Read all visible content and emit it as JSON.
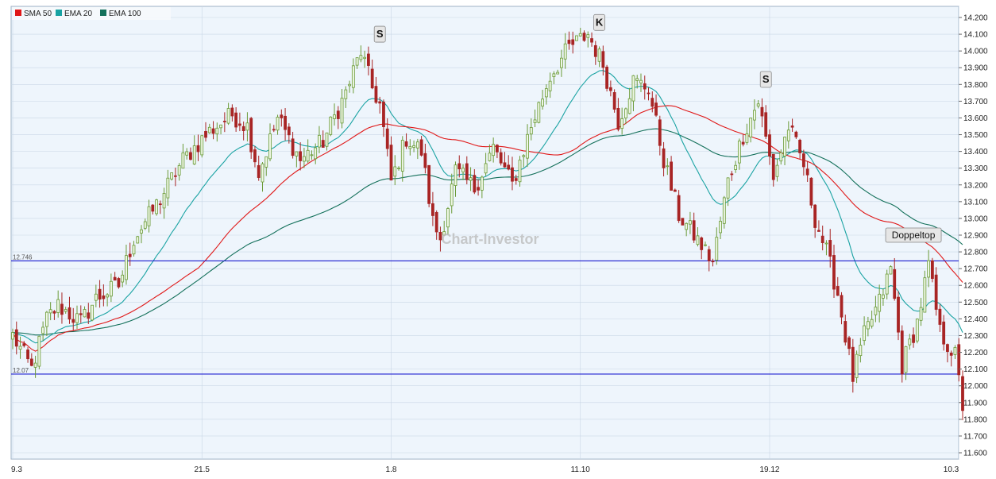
{
  "chart_data": {
    "type": "candlestick",
    "watermark": "Chart-Investor",
    "ylim": [
      11.6,
      14.2
    ],
    "grid": true,
    "legend_position": "top-left",
    "yticks": [
      "11.600",
      "11.700",
      "11.800",
      "11.900",
      "12.000",
      "12.100",
      "12.200",
      "12.300",
      "12.400",
      "12.500",
      "12.600",
      "12.700",
      "12.800",
      "12.900",
      "13.000",
      "13.100",
      "13.200",
      "13.300",
      "13.400",
      "13.500",
      "13.600",
      "13.700",
      "13.800",
      "13.900",
      "14.000",
      "14.100",
      "14.200"
    ],
    "xticks": [
      {
        "label": "9.3",
        "index": 0
      },
      {
        "label": "21.5",
        "index": 50
      },
      {
        "label": "1.8",
        "index": 100
      },
      {
        "label": "11.10",
        "index": 150
      },
      {
        "label": "19.12",
        "index": 200
      },
      {
        "label": "10.3",
        "index": 250
      }
    ],
    "n_bars": 252,
    "legend": [
      {
        "name": "SMA 50",
        "color": "#e01818"
      },
      {
        "name": "EMA 20",
        "color": "#1aa3a3"
      },
      {
        "name": "EMA 100",
        "color": "#13705a"
      }
    ],
    "hlines": [
      {
        "value": 12.746,
        "label": "12.746",
        "color": "#1a1ad0"
      },
      {
        "value": 12.07,
        "label": "12.07",
        "color": "#1a1ad0"
      }
    ],
    "annotations": [
      {
        "text": "S",
        "index": 97,
        "y": 14.1
      },
      {
        "text": "K",
        "index": 155,
        "y": 14.17
      },
      {
        "text": "S",
        "index": 199,
        "y": 13.83
      },
      {
        "text": "Doppeltop",
        "index": 238,
        "y": 12.9
      }
    ],
    "colors": {
      "up": "#6a9a36",
      "down": "#a82424",
      "plot_bg": "#eef5fc",
      "grid": "#c9d7e6"
    },
    "close_path": [
      [
        0,
        12.3
      ],
      [
        5,
        12.1
      ],
      [
        9,
        12.4
      ],
      [
        12,
        12.48
      ],
      [
        18,
        12.38
      ],
      [
        22,
        12.52
      ],
      [
        28,
        12.6
      ],
      [
        32,
        12.88
      ],
      [
        38,
        13.08
      ],
      [
        45,
        13.35
      ],
      [
        52,
        13.52
      ],
      [
        58,
        13.62
      ],
      [
        62,
        13.55
      ],
      [
        65,
        13.27
      ],
      [
        70,
        13.6
      ],
      [
        76,
        13.35
      ],
      [
        82,
        13.46
      ],
      [
        88,
        13.75
      ],
      [
        92,
        14.0
      ],
      [
        95,
        13.78
      ],
      [
        97,
        13.68
      ],
      [
        100,
        13.22
      ],
      [
        104,
        13.48
      ],
      [
        108,
        13.4
      ],
      [
        111,
        12.98
      ],
      [
        113,
        12.88
      ],
      [
        117,
        13.28
      ],
      [
        122,
        13.18
      ],
      [
        127,
        13.42
      ],
      [
        132,
        13.2
      ],
      [
        137,
        13.55
      ],
      [
        142,
        13.85
      ],
      [
        147,
        14.02
      ],
      [
        152,
        14.1
      ],
      [
        156,
        13.92
      ],
      [
        160,
        13.58
      ],
      [
        164,
        13.82
      ],
      [
        168,
        13.78
      ],
      [
        172,
        13.35
      ],
      [
        176,
        13.02
      ],
      [
        180,
        12.9
      ],
      [
        185,
        12.74
      ],
      [
        189,
        13.22
      ],
      [
        193,
        13.5
      ],
      [
        197,
        13.7
      ],
      [
        201,
        13.25
      ],
      [
        205,
        13.55
      ],
      [
        209,
        13.32
      ],
      [
        212,
        13.0
      ],
      [
        215,
        12.8
      ],
      [
        218,
        12.55
      ],
      [
        222,
        12.05
      ],
      [
        225,
        12.3
      ],
      [
        229,
        12.5
      ],
      [
        232,
        12.7
      ],
      [
        235,
        12.12
      ],
      [
        239,
        12.38
      ],
      [
        242,
        12.72
      ],
      [
        245,
        12.32
      ],
      [
        249,
        12.18
      ],
      [
        251,
        11.88
      ]
    ]
  }
}
